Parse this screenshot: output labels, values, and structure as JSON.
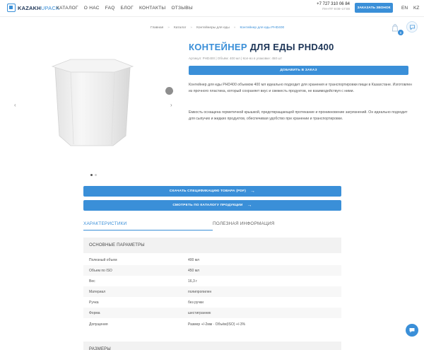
{
  "header": {
    "logo_main": "KAZAKH",
    "logo_accent": "UPACK",
    "nav": [
      "КАТАЛОГ",
      "О НАС",
      "FAQ",
      "БЛОГ",
      "КОНТАКТЫ",
      "ОТЗЫВЫ"
    ],
    "phone": "+7 727 310 06 84",
    "hours": "ПН–ПТ 9:00–17:00",
    "call_button": "ЗАКАЗАТЬ ЗВОНОК",
    "languages": [
      "EN",
      "KZ"
    ]
  },
  "breadcrumb": [
    "Главная",
    "Каталог",
    "Контейнеры для еды",
    "Контейнер для еды PHD400"
  ],
  "cart": {
    "count": "0"
  },
  "product": {
    "title_accent": "КОНТЕЙНЕР",
    "title_rest": "ДЛЯ ЕДЫ PHD400",
    "meta": "Артикул: PHD400 | Объём: 400 мл | Кол-во в упаковке: 450 шт",
    "order_button": "ДОБАВИТЬ В ЗАКАЗ",
    "description_1": "Контейнер для еды PHD400 объемом 400 мл идеально подходит для хранения и транспортировки пищи в Казахстане. Изготовлен из прочного пластика, который сохраняет вкус и свежесть продуктов, не взаимодействуя с ними.",
    "description_2": "Емкость оснащена герметичной крышкой, предотвращающей протекание и проникновение загрязнений. Он идеально подходит для сыпучих и жидких продуктов, обеспечивая удобство при хранении и транспортировке."
  },
  "buttons": {
    "spec": "СКАЧАТЬ СПЕЦИФИКАЦИЮ ТОВАРА (PDF)",
    "catalog": "СМОТРЕТЬ ПО КАТАЛОГУ ПРОДУКЦИИ"
  },
  "tabs": [
    "ХАРАКТЕРИСТИКИ",
    "ПОЛЕЗНАЯ ИНФОРМАЦИЯ"
  ],
  "spec_sections": [
    "ОСНОВНЫЕ ПАРАМЕТРЫ",
    "РАЗМЕРЫ"
  ],
  "specs": [
    {
      "key": "Полезный объем",
      "value": "400 мл"
    },
    {
      "key": "Объем по ISO",
      "value": "450 мл"
    },
    {
      "key": "Вес",
      "value": "16,3 г"
    },
    {
      "key": "Материал",
      "value": "полипропилен"
    },
    {
      "key": "Ручка",
      "value": "без ручки"
    },
    {
      "key": "Форма",
      "value": "шестигранник"
    },
    {
      "key": "Допущения",
      "value": "Размер +/-2мм · Объём(ISO) +/-3%"
    }
  ],
  "colors": {
    "accent": "#3a8fd8",
    "dark": "#1d3557"
  }
}
